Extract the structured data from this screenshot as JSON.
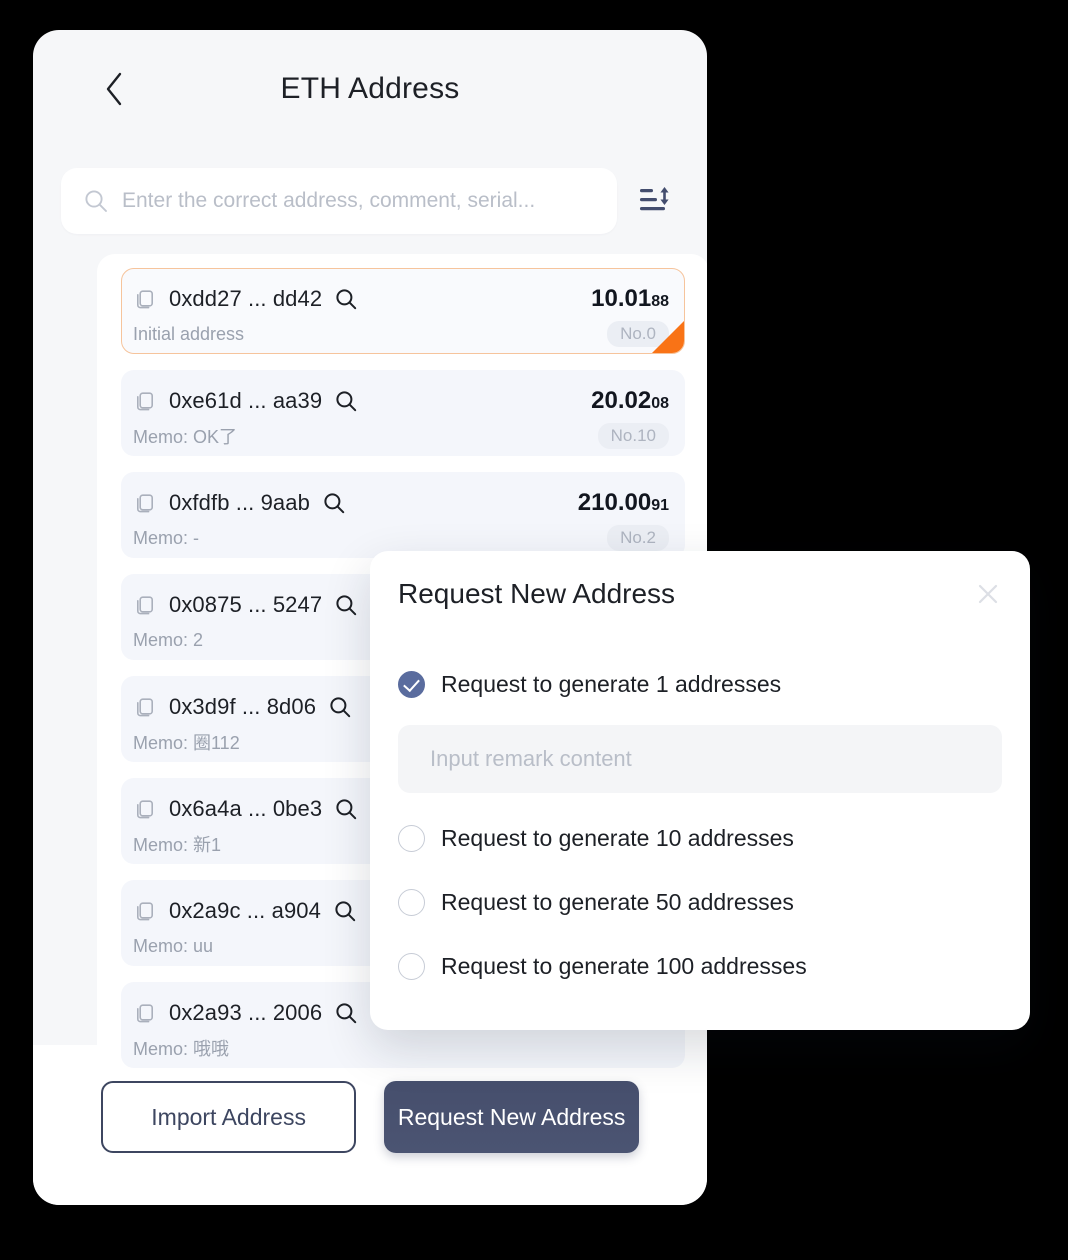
{
  "header": {
    "title": "ETH Address",
    "back_icon": "chevron-left-icon"
  },
  "search": {
    "placeholder": "Enter the correct address, comment, serial...",
    "value": "",
    "icon": "search-icon",
    "sort_icon": "sort-icon"
  },
  "list": {
    "items": [
      {
        "address": "0xdd27 ... dd42",
        "amount_main": "10.01",
        "amount_dec": "88",
        "memo": "Initial address",
        "badge": "No.0",
        "selected": true,
        "flagged": true
      },
      {
        "address": "0xe61d ... aa39",
        "amount_main": "20.02",
        "amount_dec": "08",
        "memo": "Memo: OK了",
        "badge": "No.10",
        "selected": false,
        "flagged": false
      },
      {
        "address": "0xfdfb ... 9aab",
        "amount_main": "210.00",
        "amount_dec": "91",
        "memo": "Memo: -",
        "badge": "No.2",
        "selected": false,
        "flagged": false
      },
      {
        "address": "0x0875 ... 5247",
        "amount_main": "",
        "amount_dec": "",
        "memo": "Memo: 2",
        "badge": "",
        "selected": false,
        "flagged": false
      },
      {
        "address": "0x3d9f ... 8d06",
        "amount_main": "",
        "amount_dec": "",
        "memo": "Memo: 圈112",
        "badge": "",
        "selected": false,
        "flagged": false
      },
      {
        "address": "0x6a4a ... 0be3",
        "amount_main": "",
        "amount_dec": "",
        "memo": "Memo: 新1",
        "badge": "",
        "selected": false,
        "flagged": false
      },
      {
        "address": "0x2a9c ... a904",
        "amount_main": "",
        "amount_dec": "",
        "memo": "Memo: uu",
        "badge": "",
        "selected": false,
        "flagged": false
      },
      {
        "address": "0x2a93 ... 2006",
        "amount_main": "",
        "amount_dec": "",
        "memo": "Memo: 哦哦",
        "badge": "",
        "selected": false,
        "flagged": false
      }
    ]
  },
  "footer": {
    "import_label": "Import Address",
    "request_label": "Request New Address"
  },
  "modal": {
    "title": "Request New Address",
    "close_icon": "close-icon",
    "remark_placeholder": "Input remark content",
    "remark_value": "",
    "options": [
      {
        "label": "Request to generate 1 addresses",
        "checked": true
      },
      {
        "label": "Request to generate 10 addresses",
        "checked": false
      },
      {
        "label": "Request to generate 50 addresses",
        "checked": false
      },
      {
        "label": "Request to generate 100 addresses",
        "checked": false
      }
    ]
  },
  "colors": {
    "accent_orange": "#f97316",
    "primary_navy": "#464f6d",
    "checkbox_blue": "#5a6c9e",
    "page_bg": "#f6f7f9",
    "card_bg": "#f4f6fb"
  }
}
